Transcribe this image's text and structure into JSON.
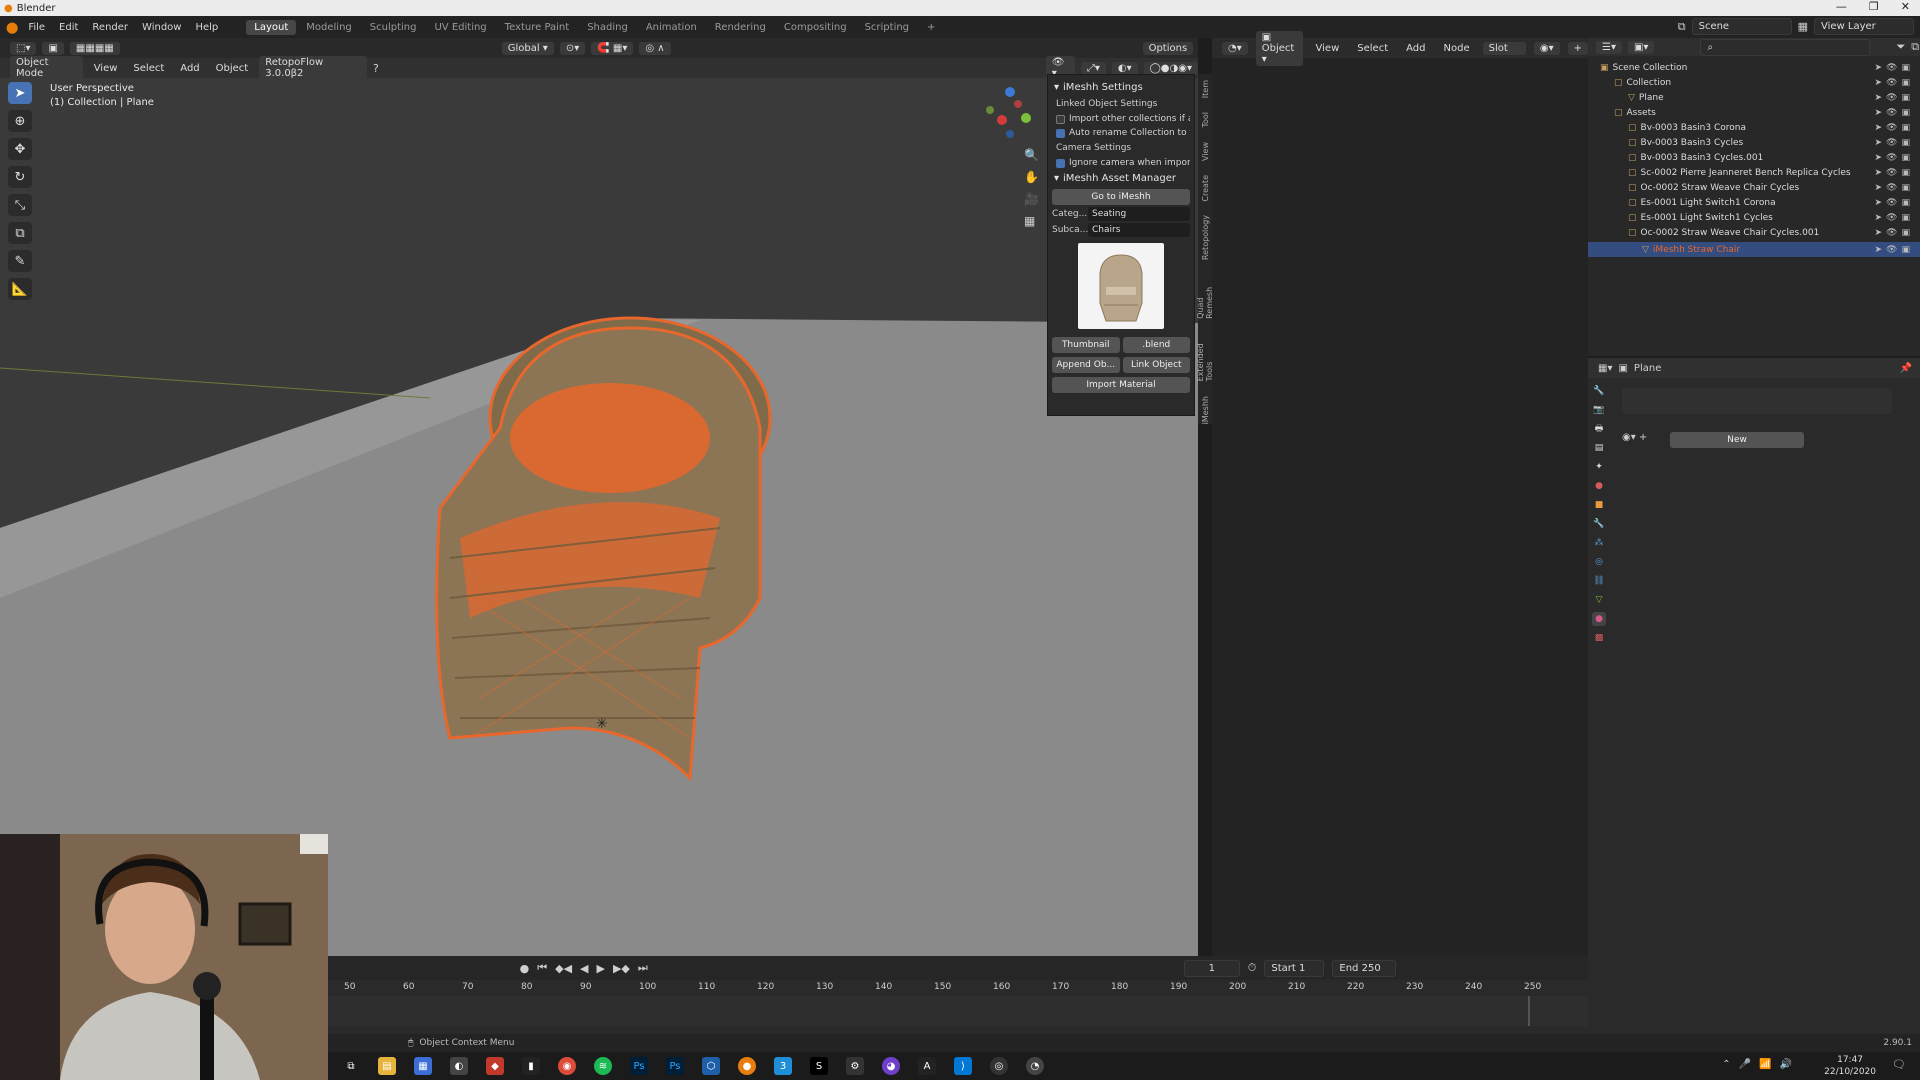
{
  "window": {
    "title": "Blender"
  },
  "menus": [
    "File",
    "Edit",
    "Render",
    "Window",
    "Help"
  ],
  "workspaces": [
    "Layout",
    "Modeling",
    "Sculpting",
    "UV Editing",
    "Texture Paint",
    "Shading",
    "Animation",
    "Rendering",
    "Compositing",
    "Scripting"
  ],
  "active_workspace": "Layout",
  "scene_field": "Scene",
  "view_layer_field": "View Layer",
  "viewport": {
    "mode": "Object Mode",
    "menus": [
      "View",
      "Select",
      "Add",
      "Object"
    ],
    "addon_menu": "RetopoFlow 3.0.0β2",
    "transform": "Global",
    "options": "Options",
    "info_line1": "User Perspective",
    "info_line2": "(1) Collection | Plane"
  },
  "npanel": {
    "settings_title": "iMeshh Settings",
    "linked_label": "Linked Object Settings",
    "chk1": "Import other collections if av...",
    "chk2": "Auto rename Collection to fil...",
    "camera_label": "Camera Settings",
    "chk3": "Ignore camera when importing",
    "manager_title": "iMeshh Asset Manager",
    "go_button": "Go to iMeshh",
    "category_key": "Categ...",
    "category_val": "Seating",
    "subcat_key": "Subca...",
    "subcat_val": "Chairs",
    "thumbnail_btn": "Thumbnail",
    "blend_btn": ".blend",
    "append_btn": "Append Ob...",
    "link_btn": "Link Object",
    "import_material_btn": "Import Material",
    "tabs": [
      "Item",
      "Tool",
      "View",
      "Create",
      "Retopology",
      "Quad Remesh",
      "Extended Tools",
      "iMeshh"
    ]
  },
  "shader_header": {
    "object": "Object",
    "menus": [
      "View",
      "Select",
      "Add",
      "Node"
    ],
    "slot": "Slot"
  },
  "outliner": {
    "rows": [
      {
        "label": "Scene Collection",
        "indent": 0,
        "icon": "▣",
        "sel": false
      },
      {
        "label": "Collection",
        "indent": 1,
        "icon": "▢",
        "sel": false
      },
      {
        "label": "Plane",
        "indent": 2,
        "icon": "▽",
        "sel": false
      },
      {
        "label": "Assets",
        "indent": 1,
        "icon": "▢",
        "sel": false
      },
      {
        "label": "Bv-0003 Basin3 Corona",
        "indent": 2,
        "icon": "▢",
        "sel": false
      },
      {
        "label": "Bv-0003 Basin3 Cycles",
        "indent": 2,
        "icon": "▢",
        "sel": false
      },
      {
        "label": "Bv-0003 Basin3 Cycles.001",
        "indent": 2,
        "icon": "▢",
        "sel": false
      },
      {
        "label": "Sc-0002 Pierre Jeanneret Bench Replica Cycles",
        "indent": 2,
        "icon": "▢",
        "sel": false
      },
      {
        "label": "Oc-0002 Straw Weave Chair Cycles",
        "indent": 2,
        "icon": "▢",
        "sel": false
      },
      {
        "label": "Es-0001 Light Switch1 Corona",
        "indent": 2,
        "icon": "▢",
        "sel": false
      },
      {
        "label": "Es-0001 Light Switch1 Cycles",
        "indent": 2,
        "icon": "▢",
        "sel": false
      },
      {
        "label": "Oc-0002 Straw Weave Chair Cycles.001",
        "indent": 2,
        "icon": "▢",
        "sel": false
      },
      {
        "label": "iMeshh Straw Chair",
        "indent": 3,
        "icon": "▽",
        "sel": true
      }
    ]
  },
  "properties": {
    "object_name": "Plane",
    "new_button": "New"
  },
  "timeline": {
    "current_frame": "1",
    "start_label": "Start",
    "start": "1",
    "end_label": "End",
    "end": "250",
    "ticks": [
      "50",
      "60",
      "70",
      "80",
      "90",
      "100",
      "110",
      "120",
      "130",
      "140",
      "150",
      "160",
      "170",
      "180",
      "190",
      "200",
      "210",
      "220",
      "230",
      "240",
      "250"
    ]
  },
  "status": {
    "context": "Object Context Menu",
    "version": "2.90.1"
  },
  "clock": {
    "time": "17:47",
    "date": "22/10/2020"
  },
  "colors": {
    "accent": "#4772b3",
    "selection": "#e8672c",
    "viewport_bg": "#3d3d3d"
  }
}
